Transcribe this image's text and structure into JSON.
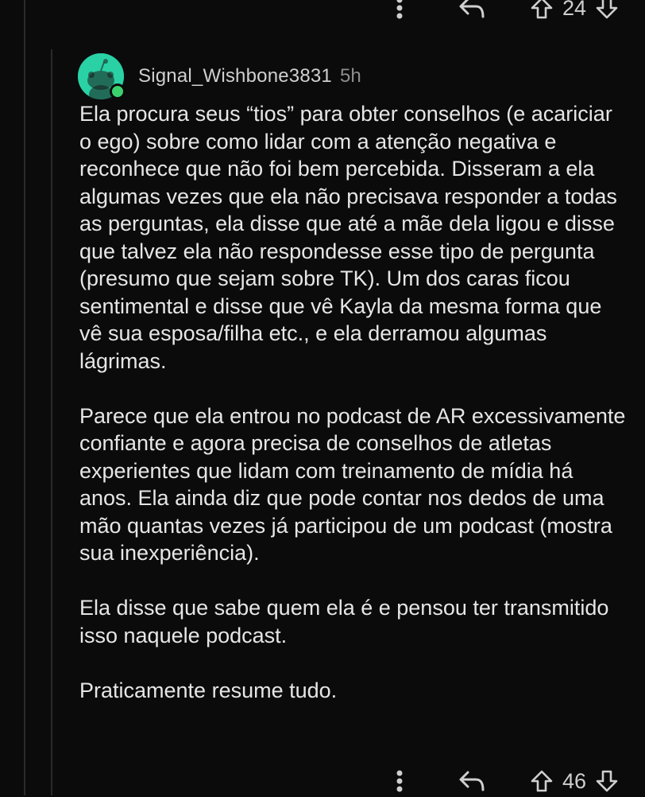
{
  "top_actions": {
    "score": "24"
  },
  "comment": {
    "username": "Signal_Wishbone3831",
    "time": "5h",
    "paragraphs": [
      "Ela procura seus “tios” para obter conselhos (e acariciar o ego) sobre como lidar com a atenção negativa e reconhece que não foi bem percebida. Disseram a ela algumas vezes que ela não precisava responder a todas as perguntas, ela disse que até a mãe dela ligou e disse que talvez ela não respondesse esse tipo de pergunta (presumo que sejam sobre TK). Um dos caras ficou sentimental e disse que vê Kayla da mesma forma que vê sua esposa/filha etc., e ela derramou algumas lágrimas.",
      "Parece que ela entrou no podcast de AR excessivamente confiante e agora precisa de conselhos de atletas experientes que lidam com treinamento de mídia há anos. Ela ainda diz que pode contar nos dedos de uma mão quantas vezes já participou de um podcast (mostra sua inexperiência).",
      "Ela disse que sabe quem ela é e pensou ter transmitido isso naquele podcast.",
      "Praticamente resume tudo."
    ],
    "score": "46"
  },
  "colors": {
    "background": "#0b0b0b",
    "avatar": "#2ad1a5",
    "online": "#3bd16f",
    "text": "#e6e6e6",
    "muted": "#8e8e8e"
  },
  "icons": [
    "more-vertical-icon",
    "reply-icon",
    "upvote-icon",
    "downvote-icon",
    "snoo-avatar-icon"
  ]
}
